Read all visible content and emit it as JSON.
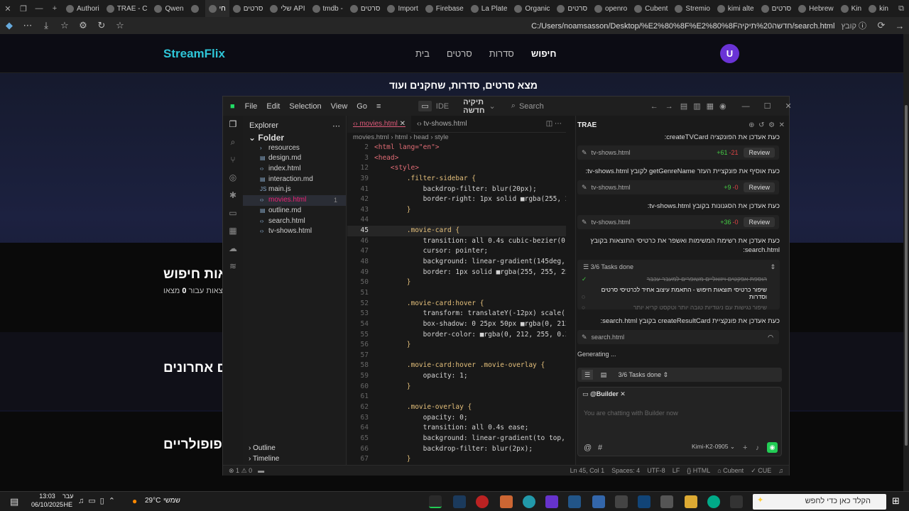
{
  "browser": {
    "tabs": [
      "Authori",
      "TRAE - C",
      "Qwen",
      "",
      "חי",
      "סרטים",
      "שלי API",
      "tmdb -",
      "סרטים",
      "Import",
      "Firebase",
      "La Plate",
      "Organic",
      "סרטים",
      "openro",
      "Cubent",
      "Stremio",
      "kimi alte",
      "סרטים",
      "Hebrew",
      "Kin",
      "kin"
    ],
    "url": "C:/Users/noamsasson/Desktop/%E2%80%8F%E2%80%8Fחדשה%20תיקיה/search.html",
    "file_label": "קובץ"
  },
  "site": {
    "logo": "StreamFlix",
    "nav": [
      "בית",
      "סרטים",
      "סדרות",
      "חיפוש"
    ],
    "avatar": "U",
    "subtitle": "מצא סרטים, סדרות, שחקנים ועוד",
    "results_title": "אות חיפוש",
    "results_count_prefix": "מצאו",
    "results_count": "0",
    "results_count_suffix": "תוצאות עבור",
    "recent_title": "ם אחרונים",
    "popular_title": "פופולריים"
  },
  "ide": {
    "menu": [
      "File",
      "Edit",
      "Selection",
      "View",
      "Go"
    ],
    "mode": "IDE",
    "project": "תיקיה חדשה",
    "search": "Search",
    "explorer_title": "Explorer",
    "folder": "Folder",
    "files": [
      {
        "name": "resources",
        "icon": "folder"
      },
      {
        "name": "design.md",
        "icon": "md"
      },
      {
        "name": "index.html",
        "icon": "html"
      },
      {
        "name": "interaction.md",
        "icon": "md"
      },
      {
        "name": "main.js",
        "icon": "js"
      },
      {
        "name": "movies.html",
        "icon": "html",
        "badge": "1"
      },
      {
        "name": "outline.md",
        "icon": "md"
      },
      {
        "name": "search.html",
        "icon": "html"
      },
      {
        "name": "tv-shows.html",
        "icon": "html"
      }
    ],
    "outline": "Outline",
    "timeline": "Timeline",
    "tabs": [
      "movies.html",
      "tv-shows.html"
    ],
    "breadcrumb": [
      "movies.html",
      "html",
      "head",
      "style"
    ],
    "code": [
      {
        "n": "2",
        "t": "<html lang=\"en\">"
      },
      {
        "n": "3",
        "t": "<head>"
      },
      {
        "n": "12",
        "t": "    <style>"
      },
      {
        "n": "39",
        "t": "        .filter-sidebar {"
      },
      {
        "n": "41",
        "t": "            backdrop-filter: blur(20px);"
      },
      {
        "n": "42",
        "t": "            border-right: 1px solid ■rgba(255, 25"
      },
      {
        "n": "43",
        "t": "        }"
      },
      {
        "n": "44",
        "t": ""
      },
      {
        "n": "45",
        "t": "        .movie-card {"
      },
      {
        "n": "46",
        "t": "            transition: all 0.4s cubic-bezier(0.4,"
      },
      {
        "n": "47",
        "t": "            cursor: pointer;"
      },
      {
        "n": "48",
        "t": "            background: linear-gradient(145deg, ■"
      },
      {
        "n": "49",
        "t": "            border: 1px solid ■rgba(255, 255, 255"
      },
      {
        "n": "50",
        "t": "        }"
      },
      {
        "n": "51",
        "t": ""
      },
      {
        "n": "52",
        "t": "        .movie-card:hover {"
      },
      {
        "n": "53",
        "t": "            transform: translateY(-12px) scale(1.0"
      },
      {
        "n": "54",
        "t": "            box-shadow: 0 25px 50px ■rgba(0, 212,"
      },
      {
        "n": "55",
        "t": "            border-color: ■rgba(0, 212, 255, 0.3)"
      },
      {
        "n": "56",
        "t": "        }"
      },
      {
        "n": "57",
        "t": ""
      },
      {
        "n": "58",
        "t": "        .movie-card:hover .movie-overlay {"
      },
      {
        "n": "59",
        "t": "            opacity: 1;"
      },
      {
        "n": "60",
        "t": "        }"
      },
      {
        "n": "61",
        "t": ""
      },
      {
        "n": "62",
        "t": "        .movie-overlay {"
      },
      {
        "n": "63",
        "t": "            opacity: 0;"
      },
      {
        "n": "64",
        "t": "            transition: all 0.4s ease;"
      },
      {
        "n": "65",
        "t": "            background: linear-gradient(to top, ■"
      },
      {
        "n": "66",
        "t": "            backdrop-filter: blur(2px);"
      },
      {
        "n": "67",
        "t": "        }"
      }
    ],
    "trae": {
      "title": "TRAE",
      "top_msg": "כעת אעדכן את הפונקציה createTVCard:",
      "rows": [
        {
          "file": "tv-shows.html",
          "add": "+61",
          "del": "-21",
          "btn": "Review"
        },
        {
          "file": "tv-shows.html",
          "add": "+9",
          "del": "-0",
          "btn": "Review"
        },
        {
          "file": "tv-shows.html",
          "add": "+36",
          "del": "-0",
          "btn": "Review"
        }
      ],
      "msgs": [
        "כעת אוסיף את פונקציית העזר getGenreName לקובץ tv-shows.html:",
        "כעת אעדכן את הסגנונות בקובץ tv-shows.html:",
        "כעת אעדכן את רשימת המשימות ואשפר את כרטיסי התוצאות בקובץ search.html:"
      ],
      "tasks_label": "3/6 Tasks done",
      "tasks": [
        "הוספת אפקטים ויזואליים משופרים למעבר עכבר",
        "שיפור כרטיסי תוצאות חיפוש - התאמת עיצוב אחיד לכרטיסי סרטים וסדרות",
        "שיפור נגישות עם ניגודיות טובה יותר וטקסט קריא יותר"
      ],
      "msg4": "כעת אעדכן את פונקציית createResultCard בקובץ search.html:",
      "gen_file": "search.html",
      "generating": "Generating ...",
      "tasks_bar": "3/6 Tasks done",
      "agent": "@Builder",
      "placeholder": "You are chatting with Builder now",
      "model": "Kimi-K2-0905"
    },
    "status": {
      "errors": "1",
      "warnings": "0",
      "pos": "Ln 45, Col 1",
      "spaces": "Spaces: 4",
      "enc": "UTF-8",
      "eol": "LF",
      "lang": "HTML",
      "ext": "Cubent",
      "cue": "CUE"
    }
  },
  "taskbar": {
    "time": "13:03",
    "date": "06/10/2025",
    "lang1": "עבר",
    "lang2": "HE",
    "weather_temp": "29°C",
    "weather_desc": "שמשי",
    "search": "הקלד כאן כדי לחפש"
  }
}
